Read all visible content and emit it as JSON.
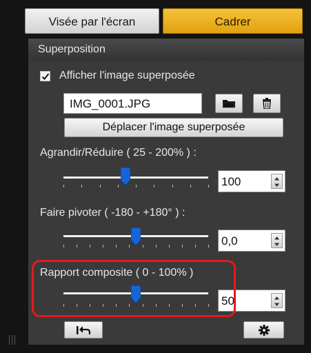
{
  "tabs": {
    "visee": "Visée par l'écran",
    "cadrer": "Cadrer"
  },
  "section": {
    "title": "Superposition"
  },
  "overlay": {
    "show_label": "Afficher l'image superposée",
    "show_checked": true,
    "filename": "IMG_0001.JPG",
    "move_button_label": "Déplacer l'image superposée"
  },
  "sliders": {
    "resize": {
      "label": "Agrandir/Réduire ( 25 - 200% ) :",
      "value": "100",
      "level": 0.43
    },
    "rotate": {
      "label": "Faire pivoter ( -180 - +180° ) :",
      "value": "0,0",
      "level": 0.5
    },
    "composite": {
      "label": "Rapport composite ( 0 - 100% )",
      "value": "50",
      "level": 0.5
    }
  },
  "icons": {
    "folder": "folder-icon",
    "trash": "trash-icon",
    "reset": "reset-icon",
    "settings": "gear-icon"
  },
  "colors": {
    "accent_tab": "#e8ad1c",
    "highlight": "#e51a1a",
    "slider_thumb": "#1565d8"
  }
}
